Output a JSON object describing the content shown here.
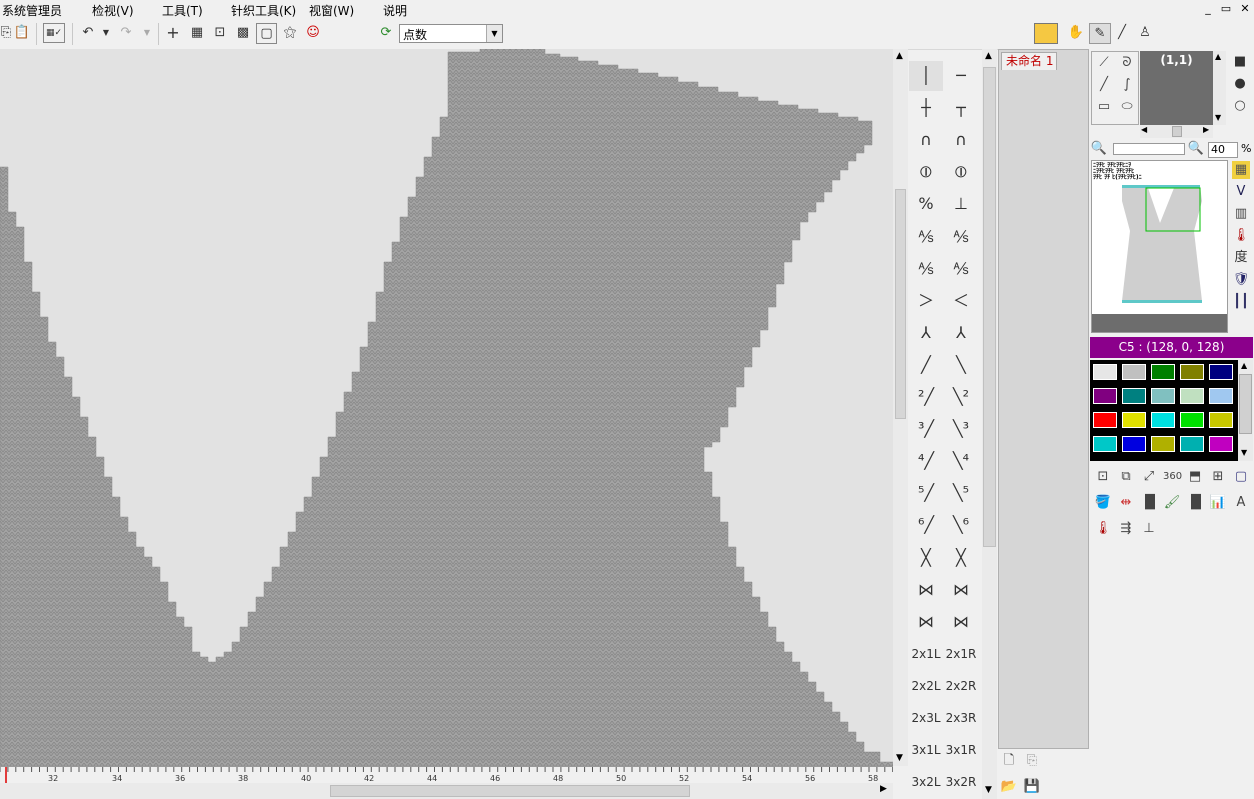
{
  "menu": [
    "系统管理员",
    "检视(V)",
    "工具(T)",
    "针织工具(K)",
    "视窗(W)",
    "说明"
  ],
  "window_buttons": [
    "_",
    "▭",
    "✕"
  ],
  "toolbar": {
    "mode_value": "点数"
  },
  "canvas": {
    "ruler_labels": [
      "32",
      "34",
      "36",
      "38",
      "40",
      "42",
      "44",
      "46",
      "48",
      "50",
      "52",
      "54",
      "56",
      "58"
    ]
  },
  "symbols": [
    [
      "│",
      "─"
    ],
    [
      "┼",
      "┬"
    ],
    [
      "∩",
      "∩"
    ],
    [
      "⦶",
      "⦶"
    ],
    [
      "%",
      "⊥"
    ],
    [
      "⅍",
      "⅍"
    ],
    [
      "⅍",
      "⅍"
    ],
    [
      "＞",
      "＜"
    ],
    [
      "⅄",
      "⅄"
    ],
    [
      "╱",
      "╲"
    ],
    [
      "²╱",
      "╲²"
    ],
    [
      "³╱",
      "╲³"
    ],
    [
      "⁴╱",
      "╲⁴"
    ],
    [
      "⁵╱",
      "╲⁵"
    ],
    [
      "⁶╱",
      "╲⁶"
    ],
    [
      "╳",
      "╳"
    ],
    [
      "⋈",
      "⋈"
    ],
    [
      "⋈",
      "⋈"
    ],
    [
      "2x1L",
      "2x1R"
    ],
    [
      "2x2L",
      "2x2R"
    ],
    [
      "2x3L",
      "2x3R"
    ],
    [
      "3x1L",
      "3x1R"
    ],
    [
      "3x2L",
      "3x2R"
    ]
  ],
  "doc_tab": "未命名 1",
  "coord": "(1,1)",
  "zoom": "40",
  "zoom_unit": "%",
  "side_label": "度",
  "preview_text": [
    "ﾆｦﾁﾋ ｦﾁﾋｦﾁﾋﾆｦ",
    "ﾆｦﾁﾋｦﾁﾋ ｦﾁﾋｦﾁﾋ",
    "ｦﾁﾋ ｦﾁ ﾋ(ｦﾁﾋｦﾁﾋ)ﾆ"
  ],
  "color_header": "C5 : (128, 0, 128)",
  "palette": [
    [
      "#e6e6e6",
      "#c0c0c0",
      "#008000",
      "#808000",
      "#000080"
    ],
    [
      "#800080",
      "#008080",
      "#80c0c0",
      "#c0e0c0",
      "#a0c8f0"
    ],
    [
      "#ff0000",
      "#e0e000",
      "#00e0e0",
      "#00e000",
      "#c8c800"
    ],
    [
      "#00c8c8",
      "#0000e0",
      "#b0b000",
      "#00b0b0",
      "#c000c0"
    ]
  ]
}
